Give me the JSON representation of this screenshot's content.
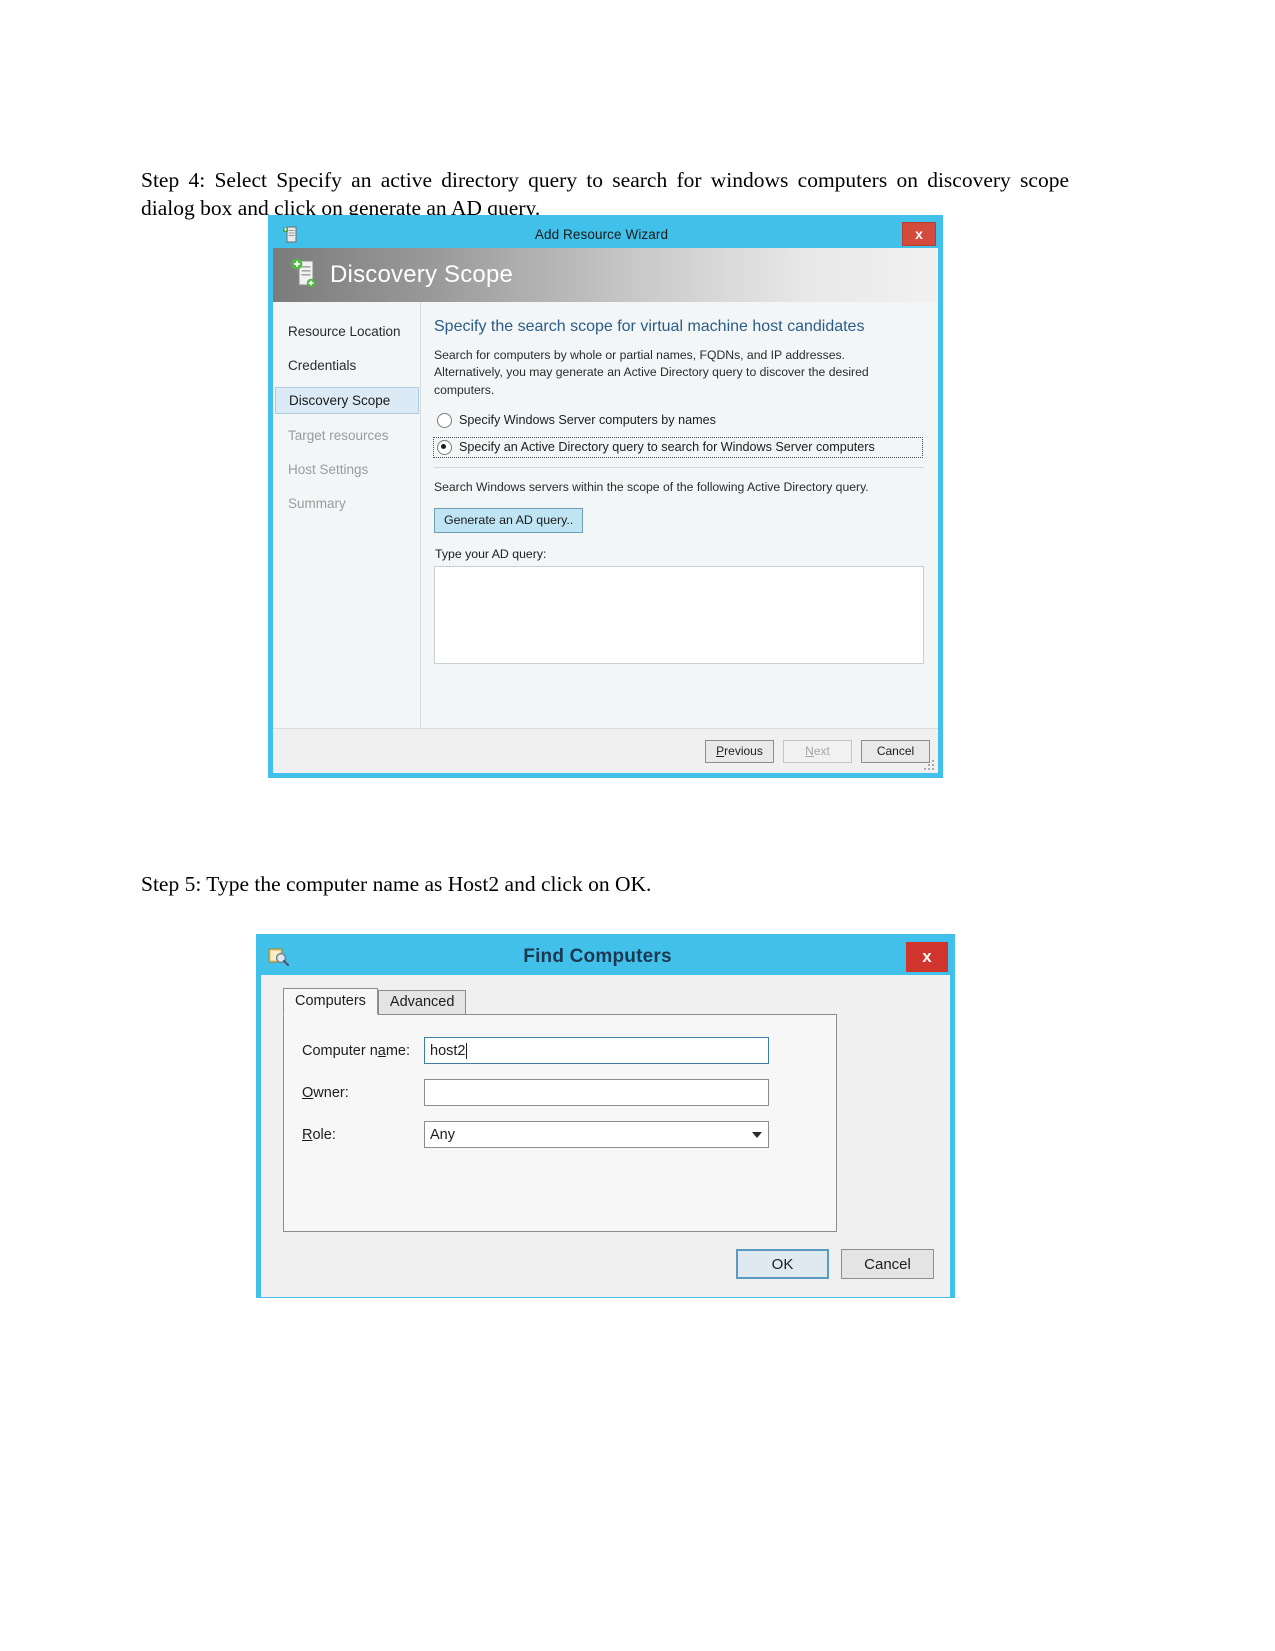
{
  "document": {
    "step4_text": "Step 4: Select Specify an active directory query to search for windows computers on discovery scope dialog box and click on generate an AD query.",
    "step5_text": "Step 5: Type the computer name as Host2 and click on OK."
  },
  "wizard": {
    "titlebar": {
      "title": "Add Resource Wizard",
      "icon": "wizard-document-icon",
      "close_label": "x"
    },
    "header": {
      "title": "Discovery Scope",
      "icon": "add-resource-icon"
    },
    "nav": {
      "items": [
        {
          "label": "Resource Location",
          "state": "normal"
        },
        {
          "label": "Credentials",
          "state": "normal"
        },
        {
          "label": "Discovery Scope",
          "state": "active"
        },
        {
          "label": "Target resources",
          "state": "dim"
        },
        {
          "label": "Host Settings",
          "state": "dim"
        },
        {
          "label": "Summary",
          "state": "dim"
        }
      ]
    },
    "pane": {
      "heading": "Specify the search scope for virtual machine host candidates",
      "description": "Search for computers by whole or partial names, FQDNs, and IP addresses. Alternatively, you may generate an Active Directory query to discover the desired computers.",
      "radio_names": "Specify Windows Server computers by names",
      "radio_adquery": "Specify an Active Directory query to search for Windows Server computers",
      "scope_text": "Search Windows servers within the scope of the following Active Directory query.",
      "generate_button": "Generate an AD query..",
      "query_label": "Type your AD query:",
      "query_value": ""
    },
    "footer": {
      "previous": "Previous",
      "next": "Next",
      "cancel": "Cancel"
    }
  },
  "find": {
    "titlebar": {
      "title": "Find Computers",
      "icon": "find-computers-icon",
      "close_label": "x"
    },
    "tabs": [
      {
        "label": "Computers",
        "active": true
      },
      {
        "label": "Advanced",
        "active": false
      }
    ],
    "fields": {
      "computer_name_label": "Computer name:",
      "computer_name_value": "host2",
      "owner_label": "Owner:",
      "owner_value": "",
      "role_label": "Role:",
      "role_value": "Any"
    },
    "buttons": {
      "ok": "OK",
      "cancel": "Cancel"
    }
  },
  "colors": {
    "accent_blue": "#41c0e9",
    "close_red": "#d0342c",
    "heading_blue": "#2b5c86",
    "selected_nav": "#dbeaf5"
  }
}
